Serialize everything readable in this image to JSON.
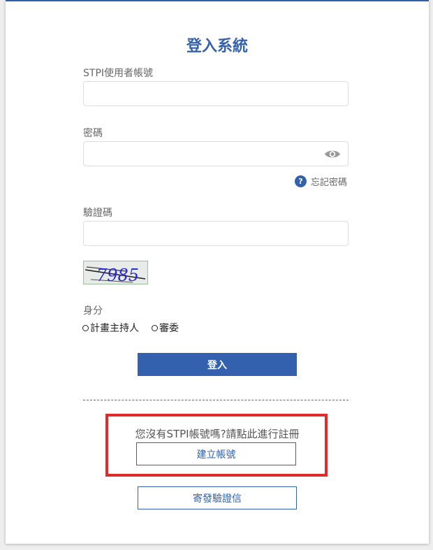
{
  "login": {
    "title": "登入系統",
    "username_label": "STPI使用者帳號",
    "username_value": "",
    "password_label": "密碼",
    "password_value": "",
    "forgot_password": "忘記密碼",
    "captcha_label": "驗證碼",
    "captcha_value": "",
    "captcha_text": "7985",
    "role_label": "身分",
    "roles": [
      "計畫主持人",
      "審委"
    ],
    "login_button": "登入"
  },
  "register": {
    "prompt": "您沒有STPI帳號嗎?請點此進行註冊",
    "create_account_button": "建立帳號",
    "resend_verification_button": "寄發驗證信"
  },
  "colors": {
    "primary": "#3461ad",
    "highlight_border": "#e02b2b"
  },
  "icons": {
    "password_toggle": "eye-icon",
    "forgot_password": "question-circle-icon"
  }
}
